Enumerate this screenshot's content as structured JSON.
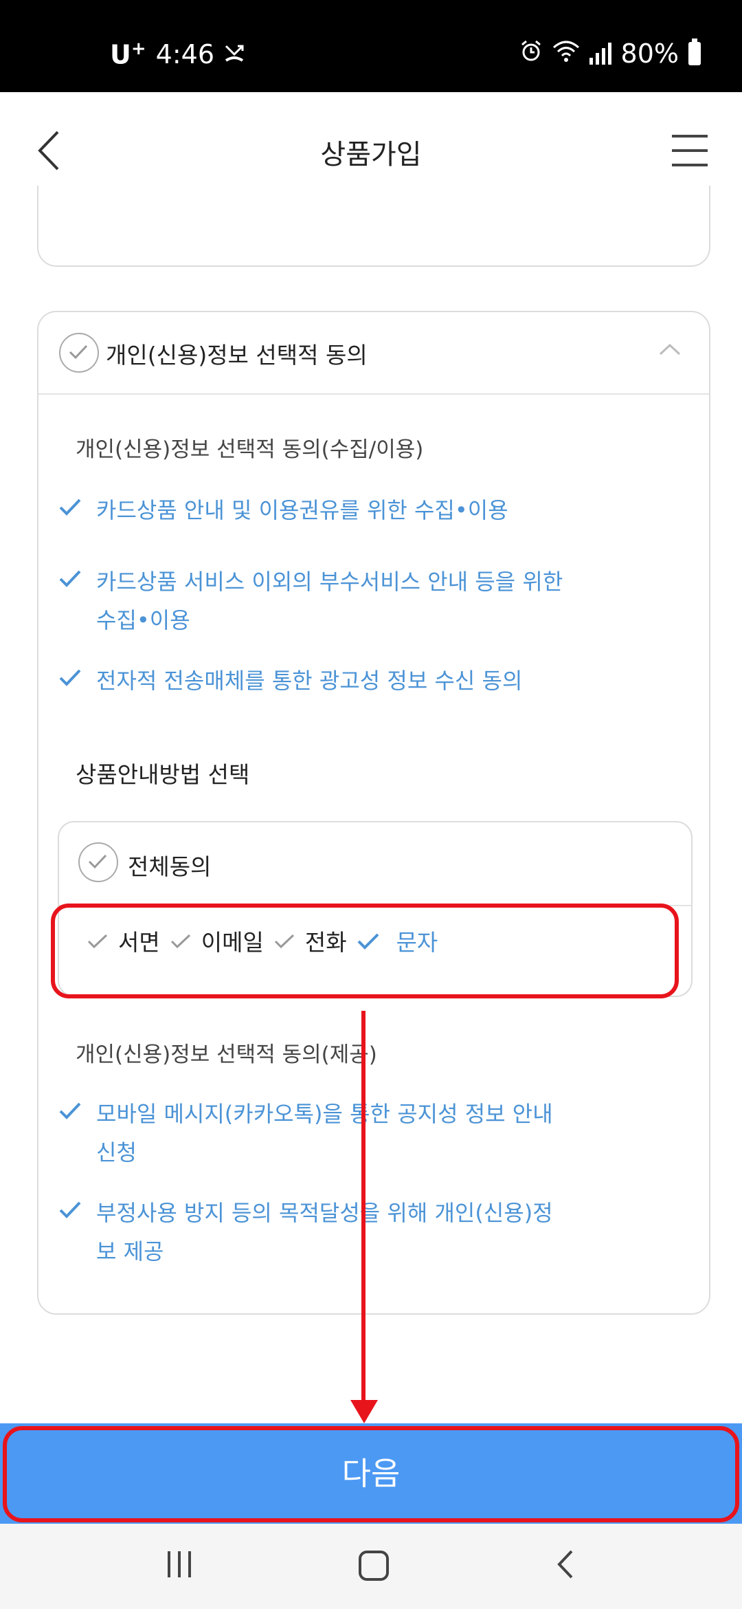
{
  "status_bar": {
    "carrier": "U",
    "carrier_plus": "+",
    "time": "4:46",
    "battery": "80%"
  },
  "header": {
    "title": "상품가입"
  },
  "consent_card": {
    "title": "개인(신용)정보 선택적 동의",
    "section1_title": "개인(신용)정보 선택적 동의(수집/이용)",
    "section1_items": [
      "카드상품 안내 및 이용권유를 위한 수집•이용",
      "카드상품 서비스 이외의 부수서비스 안내 등을 위한",
      "수집•이용",
      "전자적 전송매체를 통한 광고성 정보 수신 동의"
    ],
    "method_title": "상품안내방법 선택",
    "all_agree": "전체동의",
    "options": [
      "서면",
      "이메일",
      "전화",
      "문자"
    ],
    "section2_title": "개인(신용)정보 선택적 동의(제공)",
    "section2_items": [
      "모바일 메시지(카카오톡)을 통한 공지성 정보 안내",
      "신청",
      "부정사용 방지 등의 목적달성을 위해 개인(신용)정",
      "보 제공"
    ]
  },
  "next_button": {
    "label": "다음"
  },
  "colors": {
    "accent": "#4b93d6",
    "button": "#4c99f4",
    "highlight": "#e8141c"
  }
}
